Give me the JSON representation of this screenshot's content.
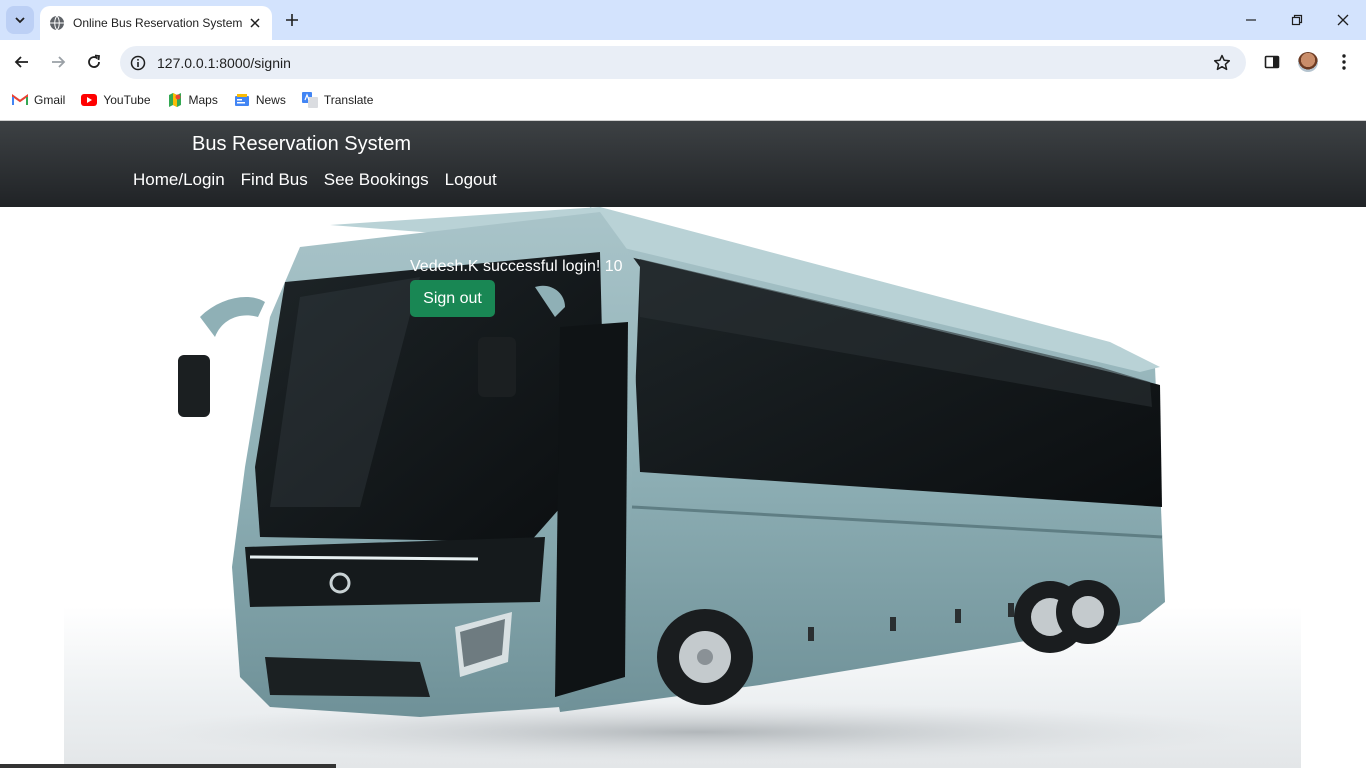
{
  "browser": {
    "tab": {
      "title": "Online Bus Reservation System"
    },
    "address_bar": {
      "url": "127.0.0.1:8000/signin"
    },
    "bookmarks": [
      {
        "label": "Gmail",
        "icon": "gmail-icon"
      },
      {
        "label": "YouTube",
        "icon": "youtube-icon"
      },
      {
        "label": "Maps",
        "icon": "maps-icon"
      },
      {
        "label": "News",
        "icon": "news-icon"
      },
      {
        "label": "Translate",
        "icon": "translate-icon"
      }
    ]
  },
  "navbar": {
    "brand": "Bus Reservation System",
    "links": [
      "Home/Login",
      "Find Bus",
      "See Bookings",
      "Logout"
    ],
    "background": "#2b2f32"
  },
  "main": {
    "message": "Vedesh.K successful login! 10",
    "signout_label": "Sign out",
    "signout_color": "#198754",
    "hero_image": "bus-image"
  }
}
